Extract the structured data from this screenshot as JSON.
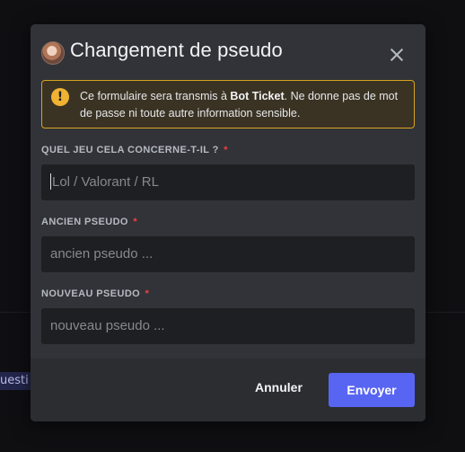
{
  "background": {
    "fragment_text": "uesti"
  },
  "modal": {
    "title": "Changement de pseudo",
    "warning": {
      "text_prefix": "Ce formulaire sera transmis à ",
      "bot_name": "Bot Ticket",
      "text_suffix": ". Ne donne pas de mot de passe ni toute autre information sensible."
    },
    "fields": [
      {
        "label": "QUEL JEU CELA CONCERNE-T-IL ?",
        "required_mark": "*",
        "placeholder": "Lol / Valorant / RL"
      },
      {
        "label": "ANCIEN PSEUDO",
        "required_mark": "*",
        "placeholder": "ancien pseudo ..."
      },
      {
        "label": "NOUVEAU PSEUDO",
        "required_mark": "*",
        "placeholder": "nouveau pseudo ..."
      }
    ],
    "buttons": {
      "cancel": "Annuler",
      "submit": "Envoyer"
    }
  },
  "colors": {
    "accent": "#5865f2",
    "warning_border": "#d9a520",
    "required": "#f23f43"
  },
  "icons": {
    "warning": "exclamation-circle-icon",
    "close": "close-icon"
  }
}
